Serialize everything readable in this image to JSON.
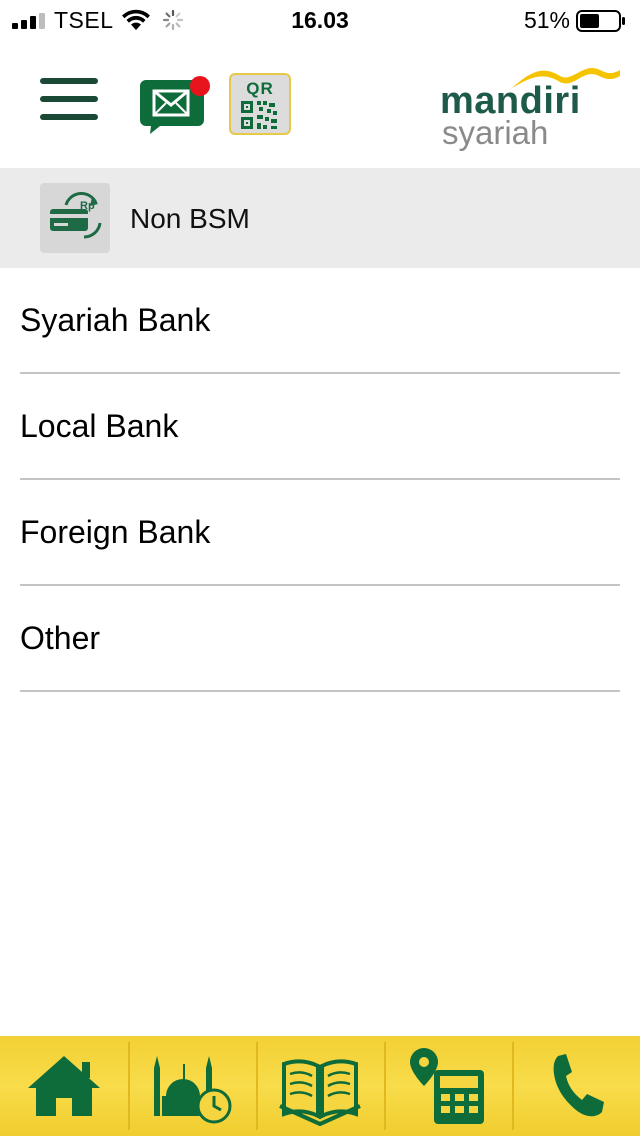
{
  "status_bar": {
    "carrier": "TSEL",
    "time": "16.03",
    "battery_percent": "51%",
    "battery_level": 0.51,
    "signal_bars": 3
  },
  "header": {
    "menu_icon": "hamburger-menu-icon",
    "inbox_icon": "mail-icon",
    "inbox_has_notification": true,
    "qr_label": "QR",
    "brand_top": "mandiri",
    "brand_bottom": "syariah"
  },
  "section": {
    "icon": "card-transfer-icon",
    "icon_text": "Rp",
    "title": "Non BSM"
  },
  "list": {
    "items": [
      {
        "label": "Syariah Bank"
      },
      {
        "label": "Local Bank"
      },
      {
        "label": "Foreign Bank"
      },
      {
        "label": "Other"
      }
    ]
  },
  "bottom_nav": {
    "items": [
      {
        "icon": "home-icon"
      },
      {
        "icon": "mosque-prayer-time-icon"
      },
      {
        "icon": "quran-book-icon"
      },
      {
        "icon": "location-calculator-icon"
      },
      {
        "icon": "phone-icon"
      }
    ]
  },
  "colors": {
    "brand_green": "#0e6b3a",
    "brand_dark_green": "#1d5a4a",
    "brand_yellow": "#f5c300",
    "nav_background": "#f8dc4a",
    "section_background": "#ebebeb",
    "notification_dot": "#e8141c"
  }
}
